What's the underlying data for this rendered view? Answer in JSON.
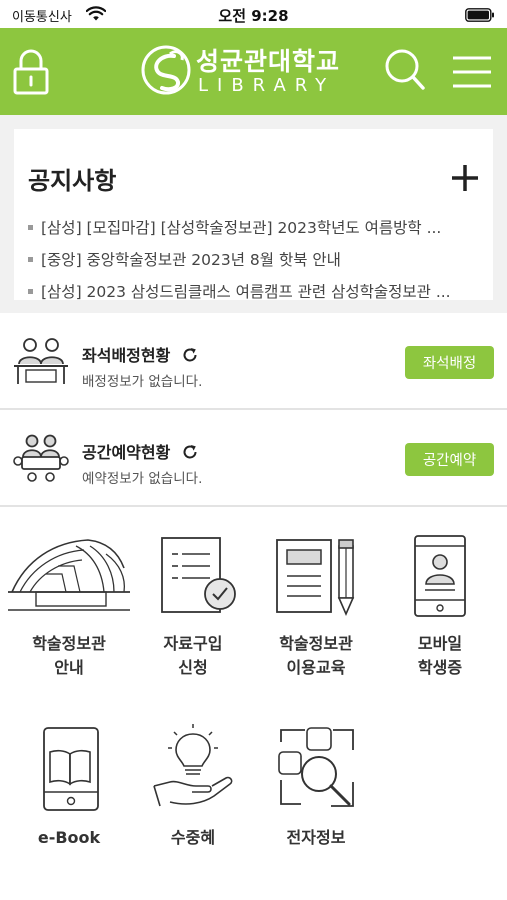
{
  "status_bar": {
    "carrier": "이동통신사",
    "time": "오전 9:28"
  },
  "header": {
    "logo_kr": "성균관대학교",
    "logo_en": "LIBRARY",
    "brand_color": "#8dc63f"
  },
  "notice": {
    "title": "공지사항",
    "items": [
      "[삼성] [모집마감] [삼성학술정보관] 2023학년도 여름방학 ...",
      "[중앙] 중앙학술정보관 2023년 8월 핫북 안내",
      "[삼성] 2023 삼성드림클래스 여름캠프 관련 삼성학술정보관 ..."
    ]
  },
  "seat": {
    "title": "좌석배정현황",
    "subtitle": "배정정보가 없습니다.",
    "button": "좌석배정"
  },
  "space": {
    "title": "공간예약현황",
    "subtitle": "예약정보가 없습니다.",
    "button": "공간예약"
  },
  "menu": [
    {
      "line1": "학술정보관",
      "line2": "안내",
      "icon": "library-building-icon"
    },
    {
      "line1": "자료구입",
      "line2": "신청",
      "icon": "document-check-icon"
    },
    {
      "line1": "학술정보관",
      "line2": "이용교육",
      "icon": "notebook-pencil-icon"
    },
    {
      "line1": "모바일",
      "line2": "학생증",
      "icon": "mobile-id-icon"
    },
    {
      "line1": "e-Book",
      "line2": "",
      "icon": "ebook-tablet-icon"
    },
    {
      "line1": "수중혜",
      "line2": "",
      "icon": "hand-lightbulb-icon"
    },
    {
      "line1": "전자정보",
      "line2": "",
      "icon": "search-database-icon"
    }
  ]
}
